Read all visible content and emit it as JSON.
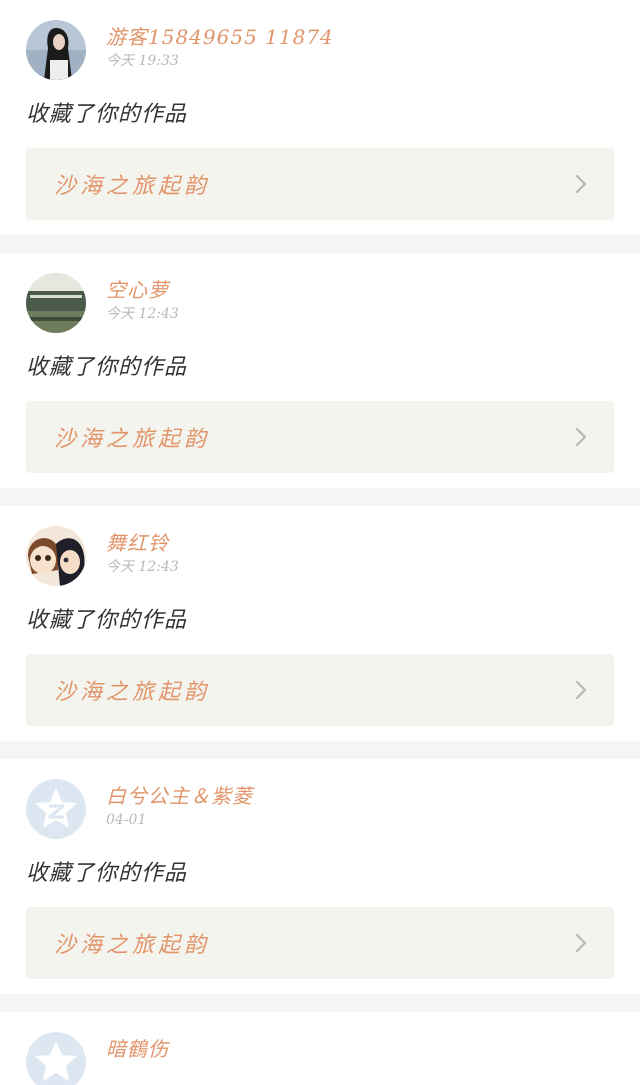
{
  "notifications": [
    {
      "username": "游客15849655 11874",
      "time": "今天 19:33",
      "action": "收藏了你的作品",
      "work_title": "沙海之旅起韵",
      "avatar": "photo-girl"
    },
    {
      "username": "空心萝",
      "time": "今天 12:43",
      "action": "收藏了你的作品",
      "work_title": "沙海之旅起韵",
      "avatar": "photo-building"
    },
    {
      "username": "舞红铃",
      "time": "今天 12:43",
      "action": "收藏了你的作品",
      "work_title": "沙海之旅起韵",
      "avatar": "anime-girls"
    },
    {
      "username": "白兮公主＆紫菱",
      "time": "04-01",
      "action": "收藏了你的作品",
      "work_title": "沙海之旅起韵",
      "avatar": "default-star"
    },
    {
      "username": "暗鶴伤",
      "avatar": "default-star"
    }
  ],
  "colors": {
    "accent": "#e2956b",
    "card_bg": "#f4f4ee",
    "divider": "#f5f5f5"
  }
}
